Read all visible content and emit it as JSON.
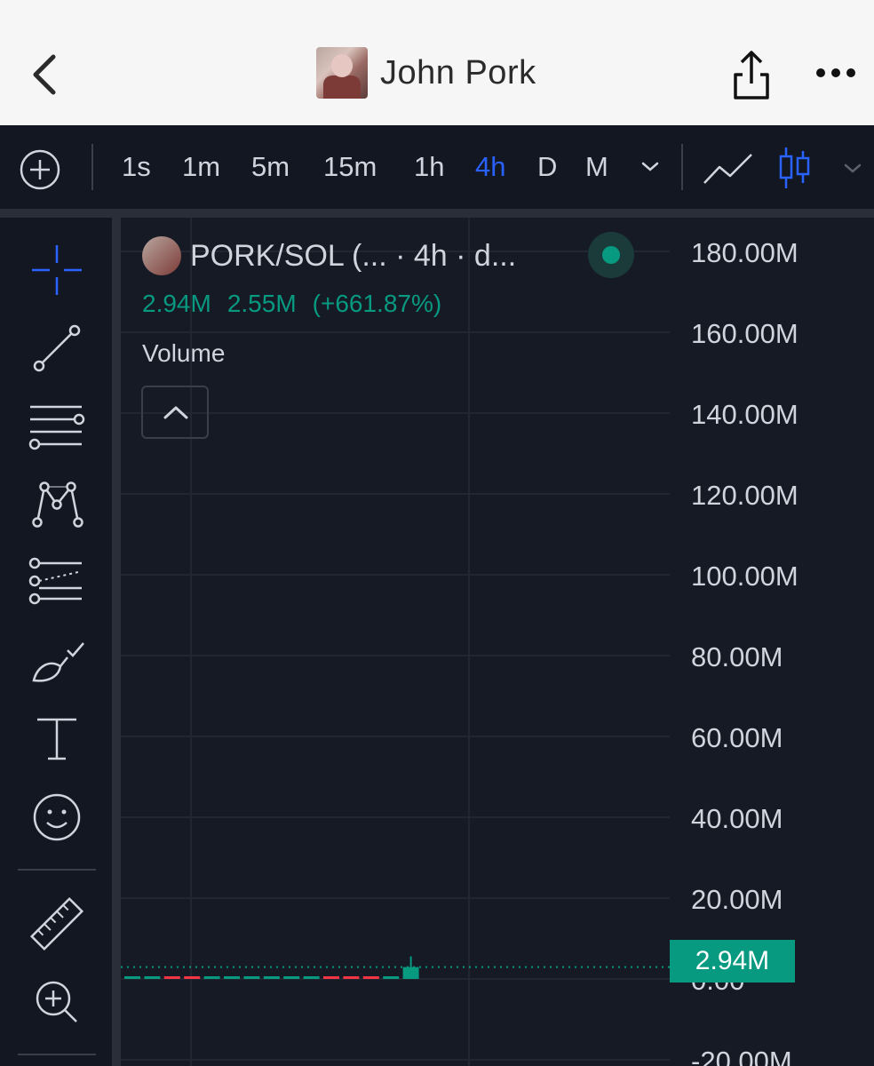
{
  "nav": {
    "title": "John Pork",
    "icons": [
      "chevron-left-icon",
      "share-icon",
      "more-horizontal-icon"
    ]
  },
  "toolbar": {
    "timeframes": [
      "1s",
      "1m",
      "5m",
      "15m",
      "1h",
      "4h",
      "D",
      "M"
    ],
    "active_timeframe": "4h",
    "accent_color": "#2962ff"
  },
  "legend": {
    "title": "PORK/SOL (... · 4h · d...",
    "value": "2.94M",
    "change": "2.55M",
    "change_pct": "(+661.87%)",
    "indicator": "Volume",
    "up_color": "#089981",
    "down_color": "#f23645"
  },
  "chart_data": {
    "type": "bar",
    "series": [
      {
        "name": "Volume",
        "values": [
          0.3,
          0.3,
          0.3,
          0.3,
          0.3,
          0.3,
          0.3,
          0.3,
          0.3,
          0.3,
          0.3,
          0.3,
          0.3,
          0.3,
          2.94
        ],
        "directions": [
          "up",
          "up",
          "down",
          "down",
          "up",
          "up",
          "up",
          "up",
          "up",
          "up",
          "down",
          "down",
          "down",
          "up",
          "up"
        ]
      }
    ],
    "ylim": [
      -20,
      180
    ],
    "y_ticks": [
      "180.00M",
      "160.00M",
      "140.00M",
      "120.00M",
      "100.00M",
      "80.00M",
      "60.00M",
      "40.00M",
      "20.00M",
      "0.00",
      "-20.00M"
    ],
    "last_value_label": "2.94M",
    "grid": true
  }
}
